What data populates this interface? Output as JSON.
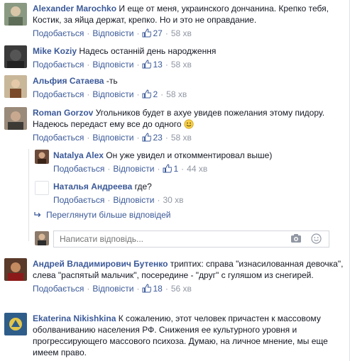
{
  "actions": {
    "like": "Подобається",
    "reply": "Відповісти"
  },
  "comments": [
    {
      "author": "Alexander Marochko",
      "text": "И еще от меня, украинского дончанина. Крепко тебя, Костик, за яйца держат, крепко. Но и это не оправдание.",
      "likes": "27",
      "time": "58 хв"
    },
    {
      "author": "Mike Koziy",
      "text": "Надесь останній день народження",
      "likes": "13",
      "time": "58 хв"
    },
    {
      "author": "Альфия Сатаева",
      "text": "-ть",
      "likes": "2",
      "time": "58 хв"
    },
    {
      "author": "Roman Gorzov",
      "text": "Угольников будет в ахуе увидев пожелания этому пидору. Надеюсь передаст ему все до одного",
      "likes": "23",
      "time": "58 хв"
    },
    {
      "author": "Андрей Владимирович Бутенко",
      "text": "триптих: справа \"изнасилованная девочка\", слева \"распятый мальчик\", посередине - \"друг\" с гуляшом из снегирей.",
      "likes": "18",
      "time": "56 хв"
    },
    {
      "author": "Ekaterina Nikishkina",
      "text": "К сожалению, этот человек причастен к массовому оболваниванию населения РФ. Снижения ее культурного уровня и прогрессирующего массового психоза. Думаю, на личное мнение, мы еще имеем право.",
      "likes": "",
      "time": ""
    }
  ],
  "replies": [
    {
      "author": "Natalya Alex",
      "text": "Он уже увидел и откомментировал выше)",
      "likes": "1",
      "time": "44 хв"
    },
    {
      "author": "Наталья Андреева",
      "text": "где?",
      "likes": "",
      "time": "30 хв"
    }
  ],
  "more_replies": "Переглянути більше відповідей",
  "reply_input": {
    "placeholder": "Написати відповідь..."
  }
}
